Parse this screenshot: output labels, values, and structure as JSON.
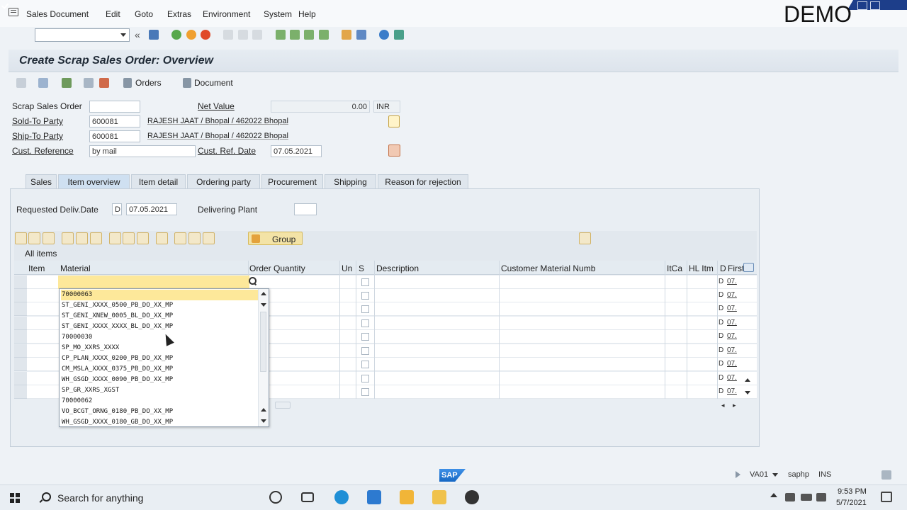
{
  "menu": [
    "Sales Document",
    "Edit",
    "Goto",
    "Extras",
    "Environment",
    "System",
    "Help"
  ],
  "watermark": "DEMO",
  "title": "Create Scrap Sales Order: Overview",
  "app_toolbar": {
    "orders_label": "Orders",
    "document_label": "Document"
  },
  "header": {
    "scrap_sales_order_label": "Scrap Sales Order",
    "scrap_sales_order_value": "",
    "net_value_label": "Net Value",
    "net_value": "0.00",
    "currency": "INR",
    "sold_to_label": "Sold-To Party",
    "sold_to_value": "600081",
    "sold_to_name": "RAJESH JAAT / Bhopal / 462022 Bhopal",
    "ship_to_label": "Ship-To Party",
    "ship_to_value": "600081",
    "ship_to_name": "RAJESH JAAT / Bhopal / 462022 Bhopal",
    "cust_ref_label": "Cust. Reference",
    "cust_ref_value": "by mail",
    "cust_ref_date_label": "Cust. Ref. Date",
    "cust_ref_date_value": "07.05.2021"
  },
  "tabs": [
    "Sales",
    "Item overview",
    "Item detail",
    "Ordering party",
    "Procurement",
    "Shipping",
    "Reason for rejection"
  ],
  "item_overview": {
    "req_deliv_label": "Requested Deliv.Date",
    "req_deliv_type": "D",
    "req_deliv_date": "07.05.2021",
    "delivering_plant_label": "Delivering Plant",
    "delivering_plant_value": "",
    "group_label": "Group",
    "all_items_label": "All items"
  },
  "columns": [
    "Item",
    "Material",
    "Order Quantity",
    "Un",
    "S",
    "Description",
    "Customer Material Numb",
    "ItCa",
    "HL Itm",
    "D",
    "First"
  ],
  "row_d": "D",
  "row_first": "07.",
  "dropdown_items": [
    "70000063",
    "ST_GENI_XXXX_0500_PB_DO_XX_MP",
    "ST_GENI_XNEW_0005_BL_DO_XX_MP",
    "ST_GENI_XXXX_XXXX_BL_DO_XX_MP",
    "70000030",
    "SP_MO_XXRS_XXXX",
    "CP_PLAN_XXXX_0200_PB_DO_XX_MP",
    "CM_MSLA_XXXX_0375_PB_DO_XX_MP",
    "WH_GSGD_XXXX_0090_PB_DO_XX_MP",
    "SP_GR_XXRS_XGST",
    "70000062",
    "VO_BCGT_ORNG_0180_PB_DO_XX_MP",
    "WH_GSGD_XXXX_0180_GB_DO_XX_MP"
  ],
  "status": {
    "tcode": "VA01",
    "host": "saphp",
    "mode": "INS",
    "logo": "SAP"
  },
  "taskbar": {
    "search": "Search for anything",
    "time": "9:53 PM",
    "date": "5/7/2021"
  }
}
